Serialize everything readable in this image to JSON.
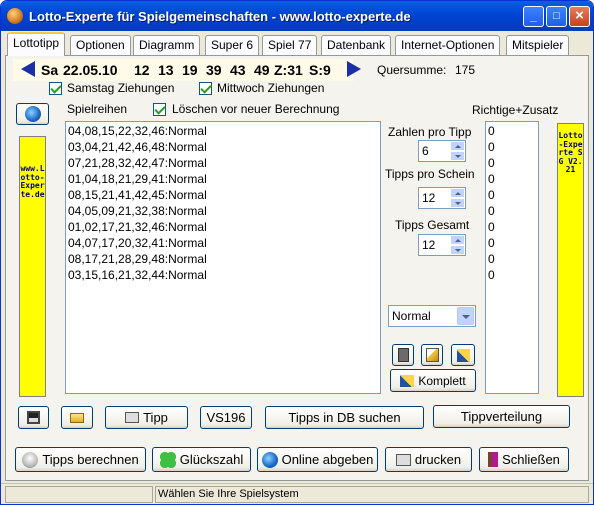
{
  "window": {
    "title": "Lotto-Experte für Spielgemeinschaften - www.lotto-experte.de",
    "controls": {
      "minimize": "_",
      "maximize": "□",
      "close": "×"
    }
  },
  "tabs": [
    "Lottotipp",
    "Optionen",
    "Diagramm",
    "Super 6",
    "Spiel 77",
    "Datenbank",
    "Internet-Optionen",
    "Mitspieler"
  ],
  "draw": {
    "day": "Sa",
    "date": "22.05.10",
    "numbers": [
      "12",
      "13",
      "19",
      "39",
      "43",
      "49"
    ],
    "zusatz": "Z:31",
    "super": "S:9",
    "checksum_label": "Quersumme:",
    "checksum_value": "175"
  },
  "checks": {
    "saturday": "Samstag Ziehungen",
    "wednesday": "Mittwoch Ziehungen",
    "clear_before": "Löschen vor neuer Berechnung"
  },
  "spielreihen": {
    "label": "Spielreihen",
    "rows": [
      "04,08,15,22,32,46:Normal",
      "03,04,21,42,46,48:Normal",
      "07,21,28,32,42,47:Normal",
      "01,04,18,21,29,41:Normal",
      "08,15,21,41,42,45:Normal",
      "04,05,09,21,32,38:Normal",
      "01,02,17,21,32,46:Normal",
      "04,07,17,20,32,41:Normal",
      "08,17,21,28,29,48:Normal",
      "03,15,16,21,32,44:Normal"
    ]
  },
  "richtige": {
    "label": "Richtige+Zusatz",
    "values": [
      "0",
      "0",
      "0",
      "0",
      "0",
      "0",
      "0",
      "0",
      "0",
      "0"
    ]
  },
  "settings": {
    "zahlen_pro_tipp_label": "Zahlen pro Tipp",
    "zahlen_pro_tipp": "6",
    "tipps_pro_schein_label": "Tipps pro Schein",
    "tipps_pro_schein": "12",
    "tipps_gesamt_label": "Tipps Gesamt",
    "tipps_gesamt": "12",
    "mode": "Normal",
    "komplett": "Komplett"
  },
  "sidebars": {
    "left": "www.Lotto-Experte.de",
    "right": "Lotto-Experte SG V2.21"
  },
  "actions": {
    "tipp": "Tipp",
    "vs196": "VS196",
    "tipps_db": "Tipps in DB suchen",
    "tippverteilung": "Tippverteilung"
  },
  "bottom": {
    "berechnen": "Tipps berechnen",
    "gluckszahl": "Glückszahl",
    "online": "Online abgeben",
    "drucken": "drucken",
    "schliessen": "Schließen"
  },
  "status": {
    "message": "Wählen Sie Ihre Spielsystem"
  },
  "colors": {
    "titlebar": "#0046d6",
    "sidebar": "#ffff00",
    "draw_bg": "#fffbe8",
    "arrow": "#1c2fa8",
    "sidebar_text": "#000080"
  }
}
